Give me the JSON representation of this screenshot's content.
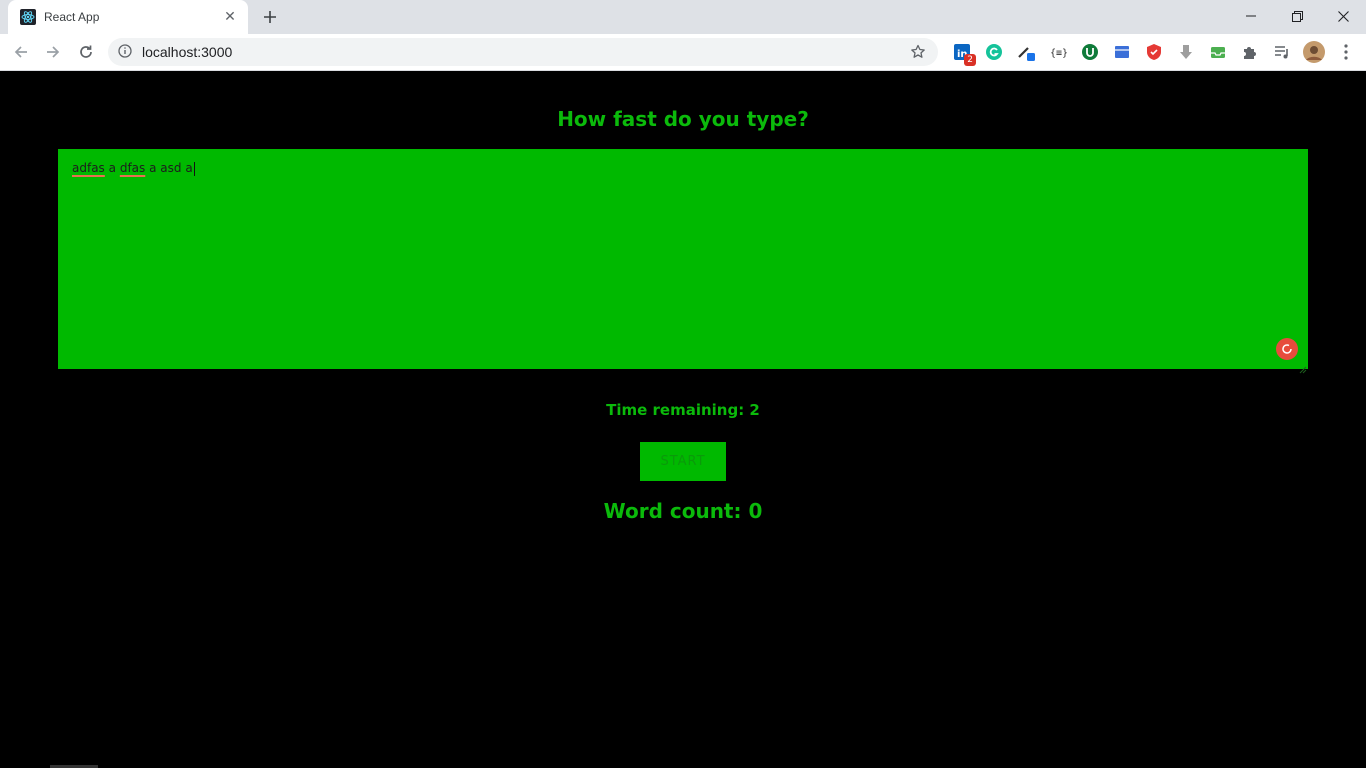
{
  "browser": {
    "tab_title": "React App",
    "url": "localhost:3000",
    "extensions": [
      {
        "icon": "linkedin-icon",
        "badge": "2"
      },
      {
        "icon": "grammarly-icon"
      },
      {
        "icon": "color-picker-icon"
      },
      {
        "icon": "json-viewer-icon"
      },
      {
        "icon": "ublock-icon"
      },
      {
        "icon": "box-extension-icon"
      },
      {
        "icon": "shield-extension-icon"
      },
      {
        "icon": "download-extension-icon"
      },
      {
        "icon": "inbox-extension-icon"
      },
      {
        "icon": "puzzle-extensions-icon"
      },
      {
        "icon": "media-playlist-icon"
      },
      {
        "icon": "profile-avatar"
      }
    ]
  },
  "app": {
    "heading": "How fast do you type?",
    "textarea": {
      "words": [
        {
          "text": "adfas",
          "misspelled": true
        },
        {
          "text": "a",
          "misspelled": false
        },
        {
          "text": "dfas",
          "misspelled": true
        },
        {
          "text": "a",
          "misspelled": false
        },
        {
          "text": "asd",
          "misspelled": false
        },
        {
          "text": "a",
          "misspelled": false
        }
      ]
    },
    "time_label": "Time remaining: 2",
    "start_label": "START",
    "word_count_label": "Word count: 0"
  },
  "colors": {
    "accent_green": "#0bba0b",
    "textarea_bg": "#00b900",
    "page_bg": "#000000"
  }
}
